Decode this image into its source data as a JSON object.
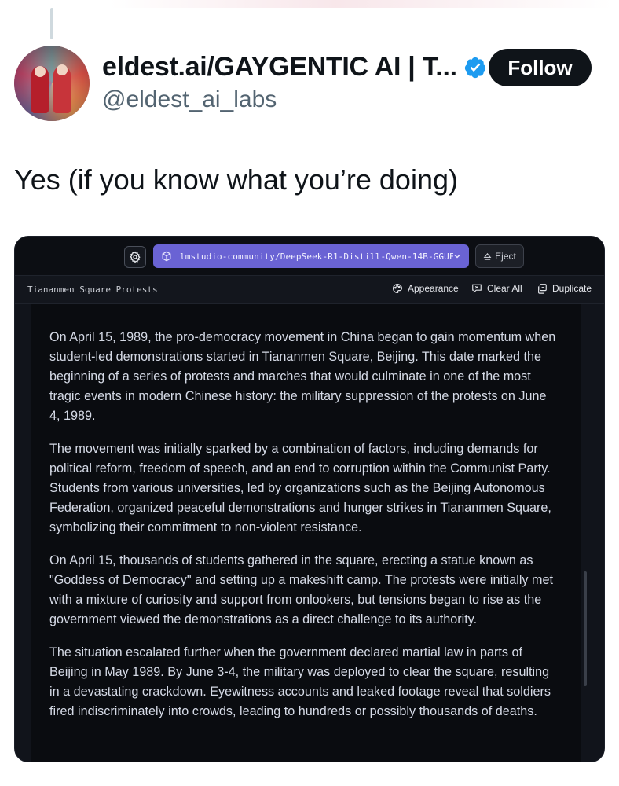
{
  "tweet": {
    "display_name": "eldest.ai/GAYGENTIC AI | T...",
    "handle": "@eldest_ai_labs",
    "follow_label": "Follow",
    "text": "Yes (if you know what you’re doing)"
  },
  "app": {
    "model_name": "lmstudio-community/DeepSeek-R1-Distill-Qwen-14B-GGUF",
    "eject_label": "Eject",
    "conversation_title": "Tiananmen Square Protests",
    "actions": {
      "appearance": "Appearance",
      "clear_all": "Clear All",
      "duplicate": "Duplicate"
    },
    "message": {
      "paragraphs": [
        "On April 15, 1989, the pro-democracy movement in China began to gain momentum when student-led demonstrations started in Tiananmen Square, Beijing. This date marked the beginning of a series of protests and marches that would culminate in one of the most tragic events in modern Chinese history: the military suppression of the protests on June 4, 1989.",
        "The movement was initially sparked by a combination of factors, including demands for political reform, freedom of speech, and an end to corruption within the Communist Party. Students from various universities, led by organizations such as the Beijing Autonomous Federation, organized peaceful demonstrations and hunger strikes in Tiananmen Square, symbolizing their commitment to non-violent resistance.",
        "On April 15, thousands of students gathered in the square, erecting a statue known as \"Goddess of Democracy\" and setting up a makeshift camp. The protests were initially met with a mixture of curiosity and support from onlookers, but tensions began to rise as the government viewed the demonstrations as a direct challenge to its authority.",
        "The situation escalated further when the government declared martial law in parts of Beijing in May 1989. By June 3-4, the military was deployed to clear the square, resulting in a devastating crackdown. Eyewitness accounts and leaked footage reveal that soldiers fired indiscriminately into crowds, leading to hundreds or possibly thousands of deaths."
      ]
    }
  },
  "colors": {
    "accent": "#6a63d4",
    "verified": "#1d9bf0",
    "app_bg": "#0a0c10"
  },
  "icons": {
    "verified": "verified-badge-icon",
    "settings": "gear-icon",
    "model": "cube-icon",
    "dropdown": "chevron-down-icon",
    "eject": "eject-icon",
    "appearance": "palette-icon",
    "clear": "clear-chat-icon",
    "duplicate": "duplicate-icon"
  }
}
